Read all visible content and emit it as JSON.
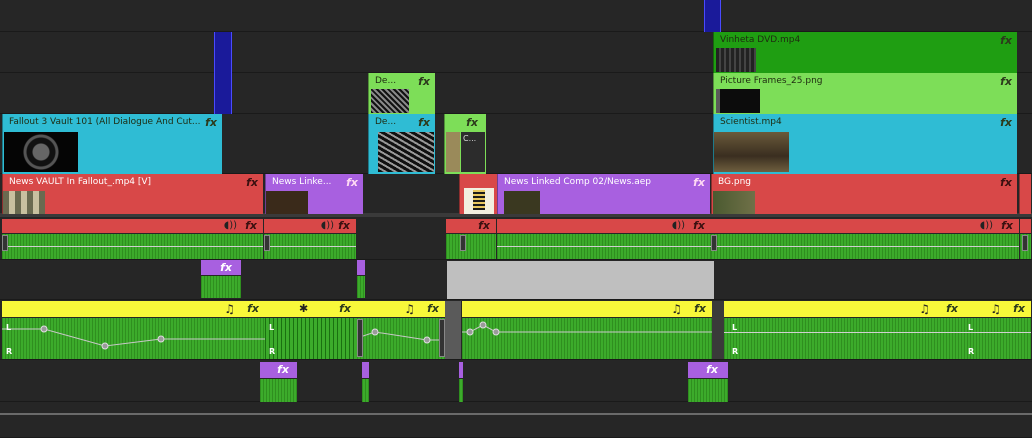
{
  "clips": {
    "vinheta": {
      "label": "Vinheta DVD.mp4",
      "fx": "fx"
    },
    "picture_frames": {
      "label": "Picture Frames_25.png",
      "fx": "fx"
    },
    "de_top": {
      "label": "De...",
      "fx": "fx"
    },
    "de_mid": {
      "label": "De...",
      "fx": "fx"
    },
    "c_small": {
      "label": "C...",
      "fx": "fx"
    },
    "fallout3": {
      "label": "Fallout 3 Vault 101 (All Dialogue And Cut...",
      "fx": "fx"
    },
    "scientist": {
      "label": "Scientist.mp4",
      "fx": "fx"
    },
    "news_vault": {
      "label": "News VAULT In Fallout_.mp4 [V]",
      "fx": "fx"
    },
    "news_linked_short": {
      "label": "News Linke...",
      "fx": "fx"
    },
    "news_linked_comp": {
      "label": "News Linked Comp 02/News.aep",
      "fx": "fx"
    },
    "bg": {
      "label": "BG.png",
      "fx": "fx"
    }
  },
  "audio": {
    "fx": "fx",
    "music_icon": "♫",
    "star_icon": "✱",
    "speaker_icon": "◖))",
    "left_channel": "L",
    "right_channel": "R"
  },
  "colors": {
    "green_dark": "#1f9e12",
    "green_light": "#7dde58",
    "cyan": "#2fbcd4",
    "red": "#d84848",
    "purple": "#a860e0",
    "yellow": "#f8f83a",
    "marker_blue": "#1a1a9a"
  }
}
